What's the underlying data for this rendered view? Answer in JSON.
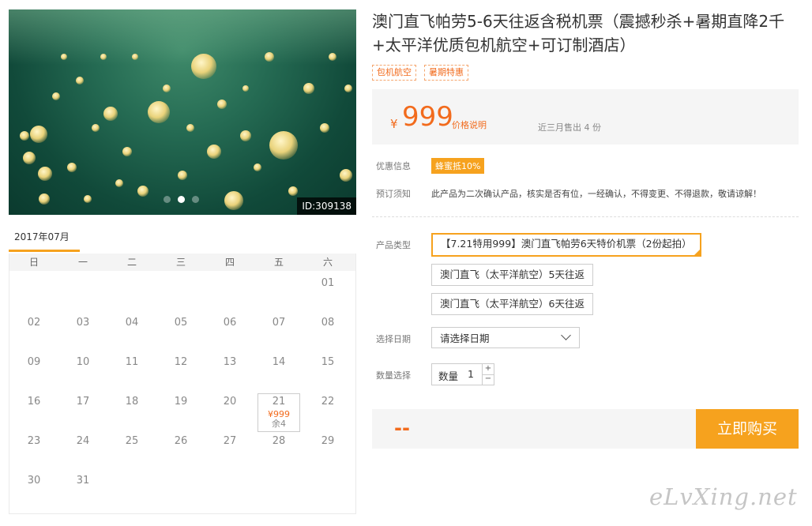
{
  "gallery": {
    "id_tag": "ID:309138",
    "active_dot": 1
  },
  "calendar": {
    "month": "2017年07月",
    "weekdays": [
      "日",
      "一",
      "二",
      "三",
      "四",
      "五",
      "六"
    ],
    "leading_blanks": 6,
    "days": [
      "01",
      "02",
      "03",
      "04",
      "05",
      "06",
      "07",
      "08",
      "09",
      "10",
      "11",
      "12",
      "13",
      "14",
      "15",
      "16",
      "17",
      "18",
      "19",
      "20",
      "21",
      "22",
      "23",
      "24",
      "25",
      "26",
      "27",
      "28",
      "29",
      "30",
      "31"
    ],
    "selected_day": "21",
    "selected_price": "¥999",
    "selected_remaining": "余4"
  },
  "product": {
    "title": "澳门直飞帕劳5-6天往返含税机票（震撼秒杀+暑期直降2千+太平洋优质包机航空+可订制酒店）",
    "tags": [
      "包机航空",
      "暑期特惠"
    ],
    "currency": "¥",
    "price": "999",
    "price_note": "价格说明",
    "sold": "近三月售出 4 份",
    "promo_label": "优惠信息",
    "promo_badge": "蜂蜜抵10%",
    "notice_label": "预订须知",
    "notice_text": "此产品为二次确认产品，核实是否有位，一经确认，不得变更、不得退款，敬请谅解！",
    "type_label": "产品类型",
    "options": [
      "【7.21特用999】澳门直飞帕劳6天特价机票（2份起拍）",
      "澳门直飞（太平洋航空）5天往返",
      "澳门直飞（太平洋航空）6天往返"
    ],
    "date_label": "选择日期",
    "date_placeholder": "请选择日期",
    "qty_label": "数量选择",
    "qty_text": "数量",
    "qty_value": "1",
    "plus": "+",
    "minus": "−",
    "total": "--",
    "buy_button": "立即购买"
  },
  "watermark": "eLvXing.net",
  "colors": {
    "accent": "#f6a21e",
    "price": "#f26b1d"
  }
}
